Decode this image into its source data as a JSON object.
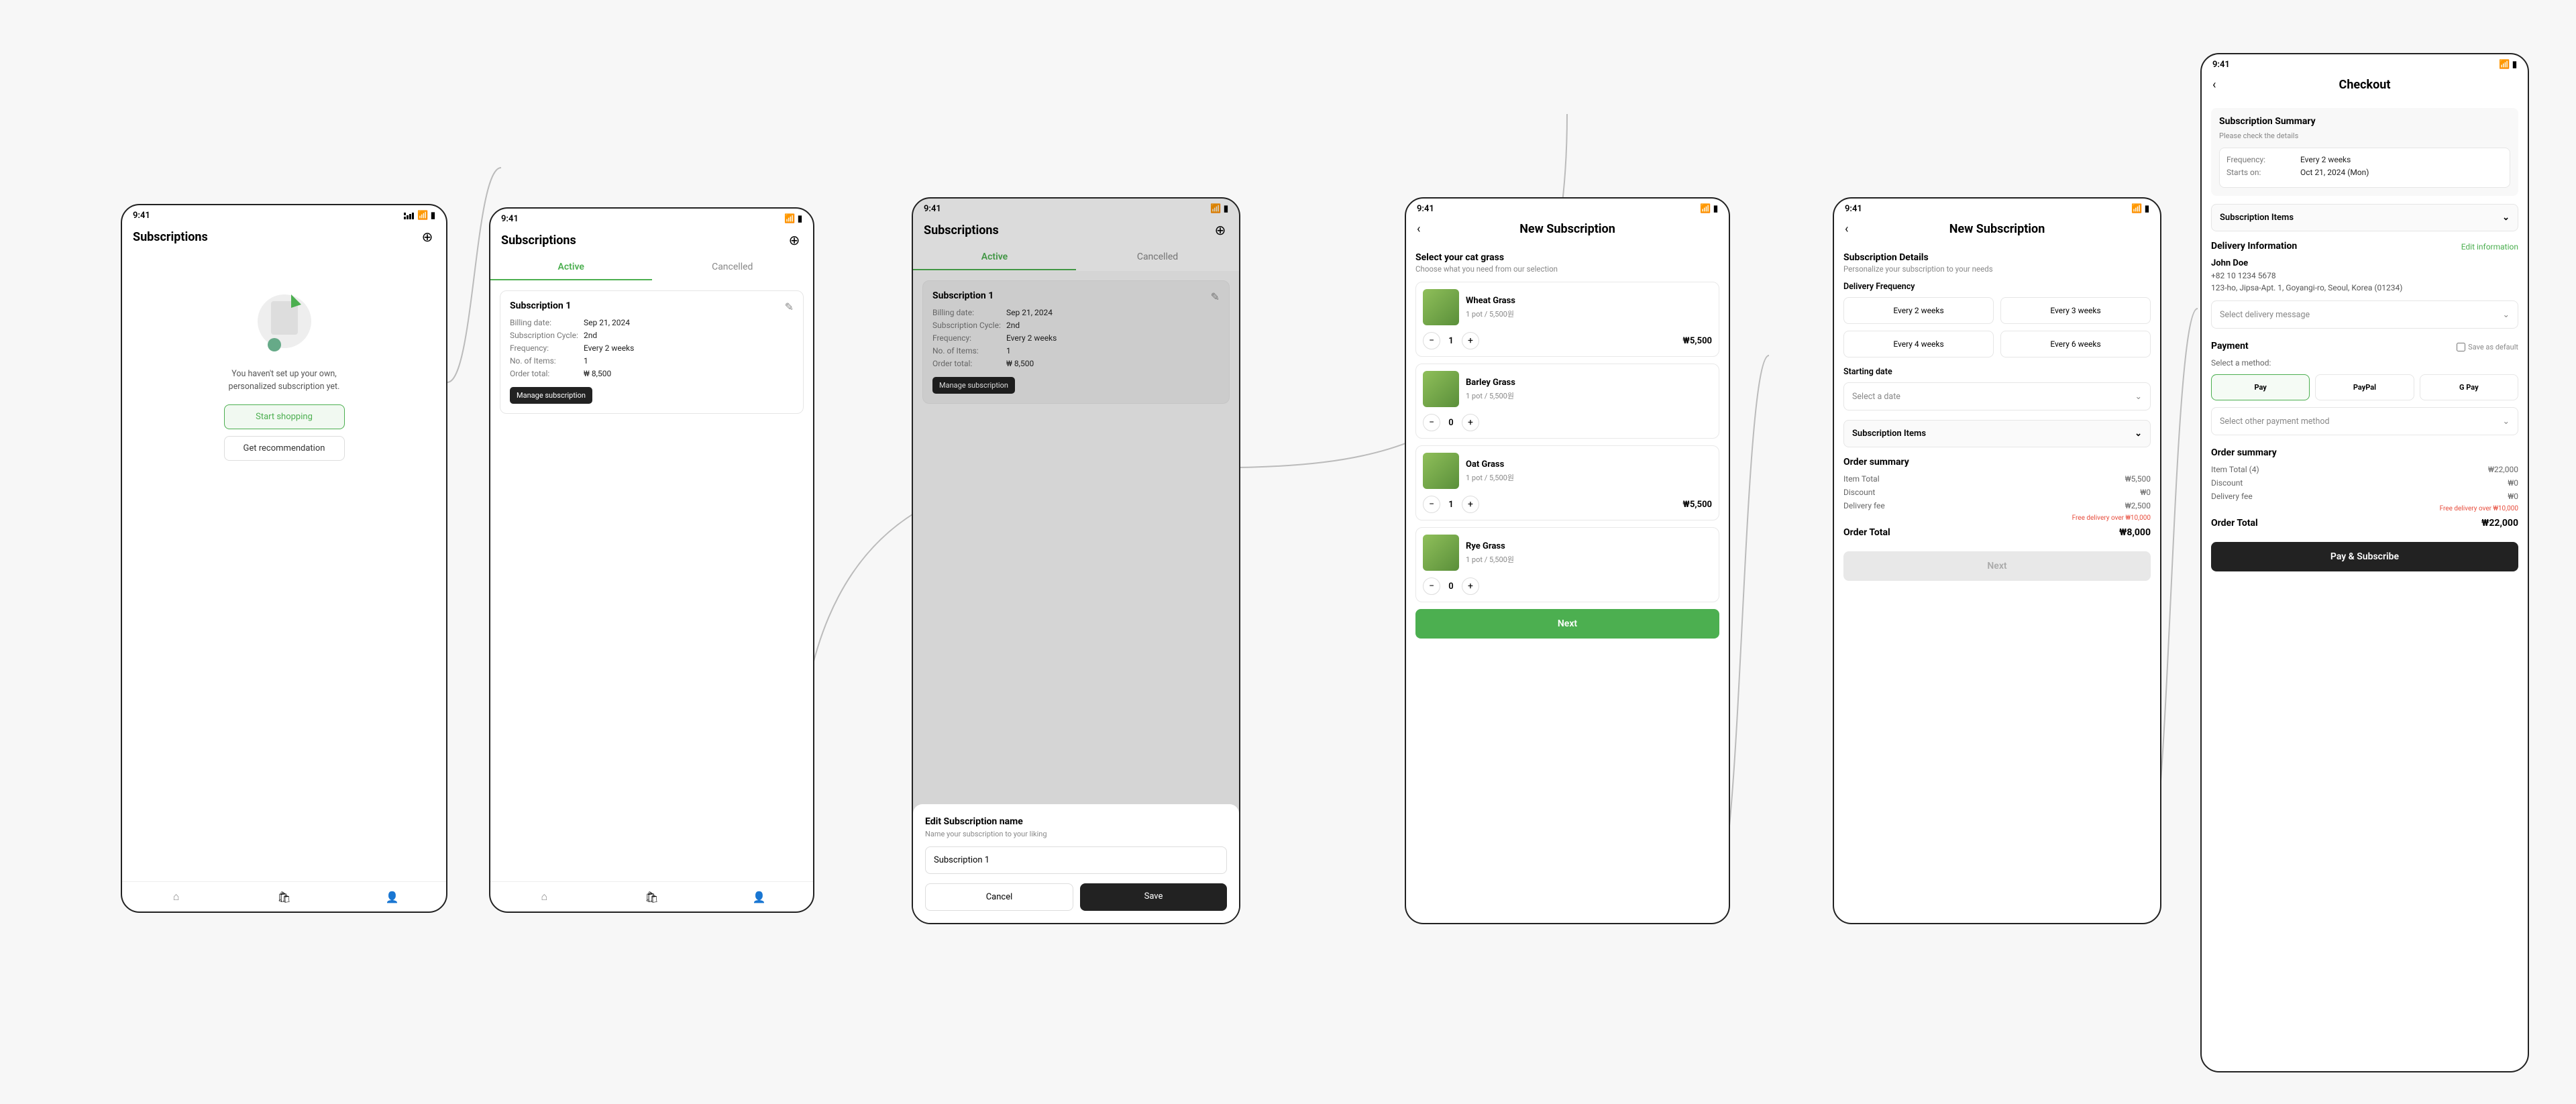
{
  "status_time": "9:41",
  "subs_title": "Subscriptions",
  "empty": {
    "line1": "You haven't set up your own,",
    "line2": "personalized subscription yet.",
    "start_btn": "Start shopping",
    "rec_btn": "Get recommendation"
  },
  "tabs": {
    "active": "Active",
    "cancelled": "Cancelled"
  },
  "sub_card": {
    "title": "Subscription 1",
    "billing_k": "Billing date:",
    "billing_v": "Sep 21, 2024",
    "cycle_k": "Subscription Cycle:",
    "cycle_v": "2nd",
    "freq_k": "Frequency:",
    "freq_v": "Every 2 weeks",
    "items_k": "No. of Items:",
    "items_v": "1",
    "total_k": "Order total:",
    "total_v": "₩ 8,500",
    "manage": "Manage subscription"
  },
  "rename": {
    "title": "Edit Subscription name",
    "sub": "Name your subscription to your liking",
    "value": "Subscription 1",
    "cancel": "Cancel",
    "save": "Save"
  },
  "cat": {
    "header": "New Subscription",
    "title": "Select your cat grass",
    "sub": "Choose what you need from our selection",
    "products": [
      {
        "name": "Wheat Grass",
        "price": "1 pot / 5,500원",
        "qty": "1",
        "sub": "₩5,500"
      },
      {
        "name": "Barley Grass",
        "price": "1 pot / 5,500원",
        "qty": "0",
        "sub": ""
      },
      {
        "name": "Oat Grass",
        "price": "1 pot / 5,500원",
        "qty": "1",
        "sub": "₩5,500"
      },
      {
        "name": "Rye Grass",
        "price": "1 pot / 5,500원",
        "qty": "0",
        "sub": ""
      }
    ],
    "next": "Next"
  },
  "details": {
    "header": "New Subscription",
    "title": "Subscription Details",
    "sub": "Personalize your subscription to your needs",
    "freq_label": "Delivery Frequency",
    "freqs": [
      "Every 2 weeks",
      "Every 3 weeks",
      "Every 4 weeks",
      "Every 6 weeks"
    ],
    "start_label": "Starting date",
    "date_ph": "Select a date",
    "items_collapse": "Subscription Items",
    "summary_title": "Order summary",
    "rows": [
      {
        "k": "Item Total",
        "v": "₩5,500"
      },
      {
        "k": "Discount",
        "v": "₩0"
      },
      {
        "k": "Delivery fee",
        "v": "₩2,500"
      }
    ],
    "free": "Free delivery over ₩10,000",
    "total_k": "Order Total",
    "total_v": "₩8,000",
    "next": "Next"
  },
  "checkout": {
    "header": "Checkout",
    "sum_title": "Subscription Summary",
    "sum_sub": "Please check the details",
    "freq_k": "Frequency:",
    "freq_v": "Every 2 weeks",
    "start_k": "Starts on:",
    "start_v": "Oct 21, 2024 (Mon)",
    "items_collapse": "Subscription Items",
    "delivery_title": "Delivery Information",
    "edit_info": "Edit information",
    "name": "John Doe",
    "phone": "+82 10 1234 5678",
    "addr": "123-ho, Jipsa-Apt. 1, Goyangi-ro, Seoul, Korea (01234)",
    "msg_ph": "Select delivery message",
    "pay_title": "Payment",
    "save_default": "Save as default",
    "method_label": "Select a method:",
    "methods": [
      "Pay",
      "PayPal",
      "G Pay"
    ],
    "other_ph": "Select other payment method",
    "summary_title": "Order summary",
    "rows": [
      {
        "k": "Item Total (4)",
        "v": "₩22,000"
      },
      {
        "k": "Discount",
        "v": "₩0"
      },
      {
        "k": "Delivery fee",
        "v": "₩0"
      }
    ],
    "free": "Free delivery over ₩10,000",
    "total_k": "Order Total",
    "total_v": "₩22,000",
    "pay_btn": "Pay & Subscribe"
  }
}
